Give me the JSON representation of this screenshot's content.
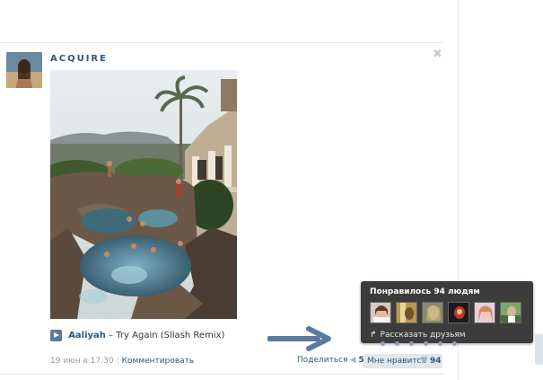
{
  "post": {
    "author": "ACQUIRE",
    "close": "✖",
    "audio": {
      "artist": "Aaliyah",
      "dash": "–",
      "title": "Try Again (Sllash Remix)"
    },
    "date": "19 июн в 17:30",
    "separator": "|",
    "comment": "Комментировать",
    "share": {
      "label": "Поделиться",
      "icon": "megaphone-icon",
      "count": "5"
    },
    "like": {
      "label": "Мне нравится",
      "icon": "heart-icon",
      "count": "94"
    }
  },
  "popup": {
    "title": "Понравилось 94 людям",
    "tell_friends": "Рассказать друзьям",
    "tell_icon": "share-arrow-icon",
    "liker_count": 6
  },
  "colors": {
    "link": "#2b587a",
    "popup_bg": "#3c3c3c",
    "like_bg": "#e1e7ed",
    "arrow": "#5a7a9e"
  }
}
